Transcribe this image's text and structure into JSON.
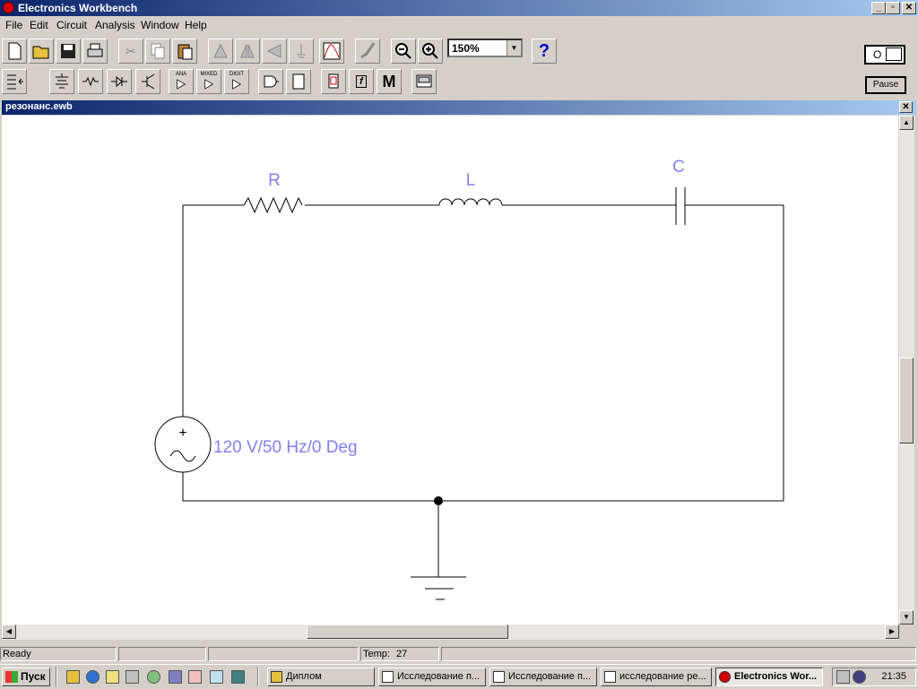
{
  "app": {
    "title": "Electronics Workbench"
  },
  "menu": [
    "File",
    "Edit",
    "Circuit",
    "Analysis",
    "Window",
    "Help"
  ],
  "toolbar": {
    "zoom_value": "150%",
    "help_label": "?",
    "pause_label": "Pause",
    "power_label": "O",
    "parts_labels": {
      "ana": "ANA",
      "mixed": "MIXED",
      "digit": "DIGIT",
      "misc": "M",
      "func": "f"
    }
  },
  "document": {
    "title": "резонанс.ewb"
  },
  "circuit": {
    "resistor_label": "R",
    "inductor_label": "L",
    "capacitor_label": "C",
    "source_label": "120 V/50 Hz/0 Deg",
    "source_symbol": "+",
    "label_color": "#8080f0"
  },
  "status": {
    "ready": "Ready",
    "temp_label": "Temp:",
    "temp_value": "27"
  },
  "taskbar": {
    "start_label": "Пуск",
    "tasks": [
      "Диплом",
      "Исследование п...",
      "Исследование п...",
      "исследование ре...",
      "Electronics Wor..."
    ],
    "clock": "21:35"
  }
}
